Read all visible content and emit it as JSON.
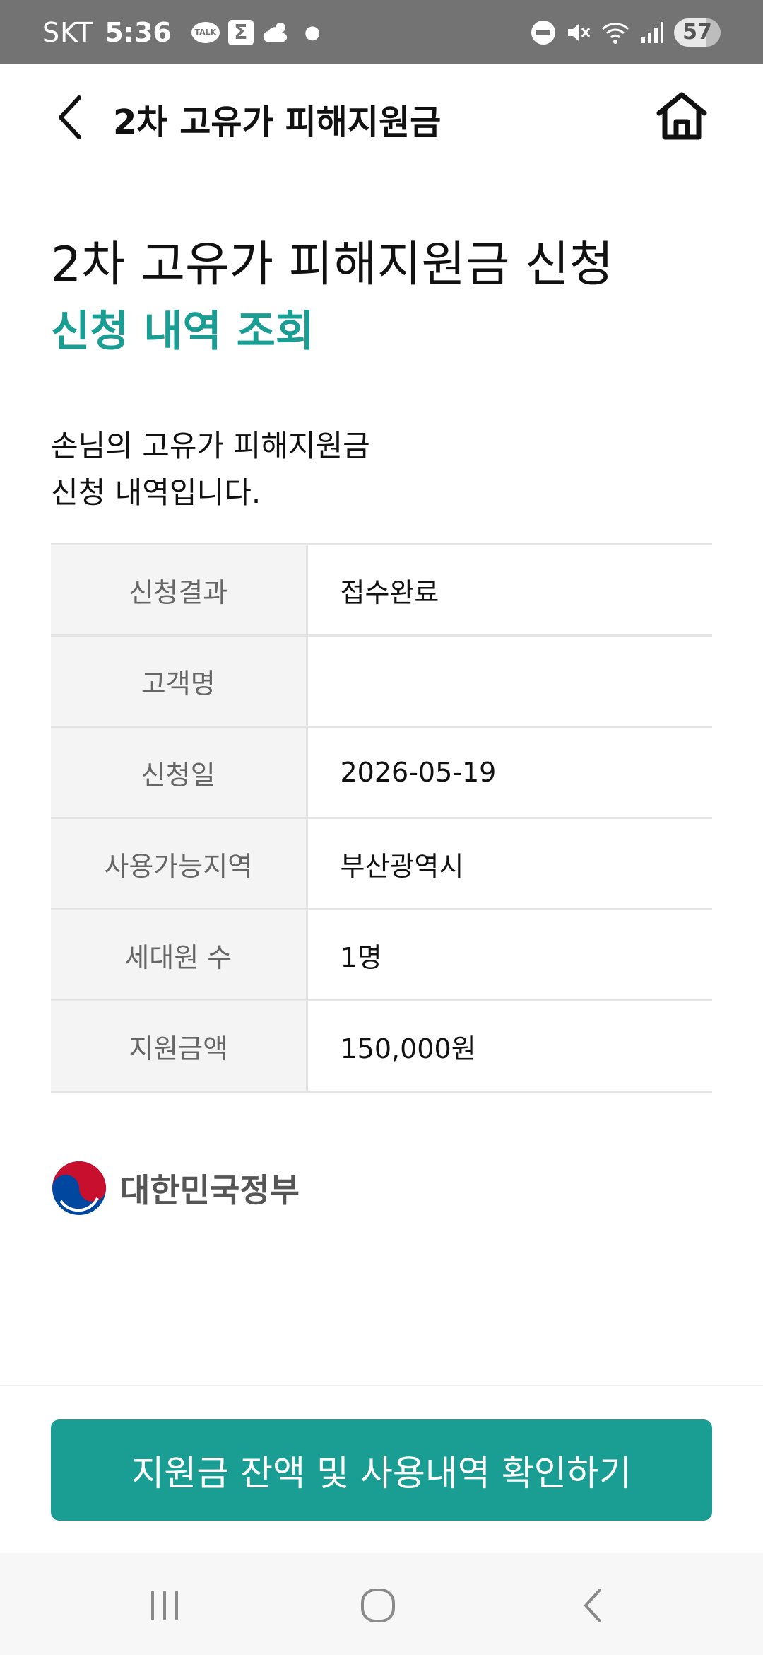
{
  "status_bar": {
    "carrier": "SKT",
    "time": "5:36",
    "talk_icon_label": "TALK",
    "sigma_glyph": "Σ",
    "battery": "57",
    "icons": [
      "kakaotalk-icon",
      "sigma-app-icon",
      "weather-icon",
      "notification-dot-icon",
      "dnd-icon",
      "mute-icon",
      "wifi-icon",
      "signal-icon",
      "battery-icon"
    ]
  },
  "header": {
    "title": "2차 고유가 피해지원금",
    "back_icon": "chevron-left-icon",
    "home_icon": "home-icon"
  },
  "main": {
    "title": "2차 고유가 피해지원금 신청",
    "subtitle": "신청 내역 조회",
    "intro_line1": "손님의 고유가 피해지원금",
    "intro_line2": "신청 내역입니다."
  },
  "table": {
    "rows": [
      {
        "label": "신청결과",
        "value": "접수완료"
      },
      {
        "label": "고객명",
        "value": ""
      },
      {
        "label": "신청일",
        "value": "2026-05-19"
      },
      {
        "label": "사용가능지역",
        "value": "부산광역시"
      },
      {
        "label": "세대원 수",
        "value": "1명"
      },
      {
        "label": "지원금액",
        "value": "150,000원"
      }
    ]
  },
  "logo": {
    "name": "대한민국정부"
  },
  "footer": {
    "button_label": "지원금 잔액 및 사용내역 확인하기"
  },
  "colors": {
    "accent": "#1a9e94",
    "status_bar_bg": "#737373",
    "table_label_bg": "#f4f4f4",
    "taeguk_red": "#c8102e",
    "taeguk_blue": "#0047a0"
  },
  "nav": {
    "icons": [
      "recent-apps-icon",
      "home-circle-icon",
      "back-icon"
    ]
  }
}
